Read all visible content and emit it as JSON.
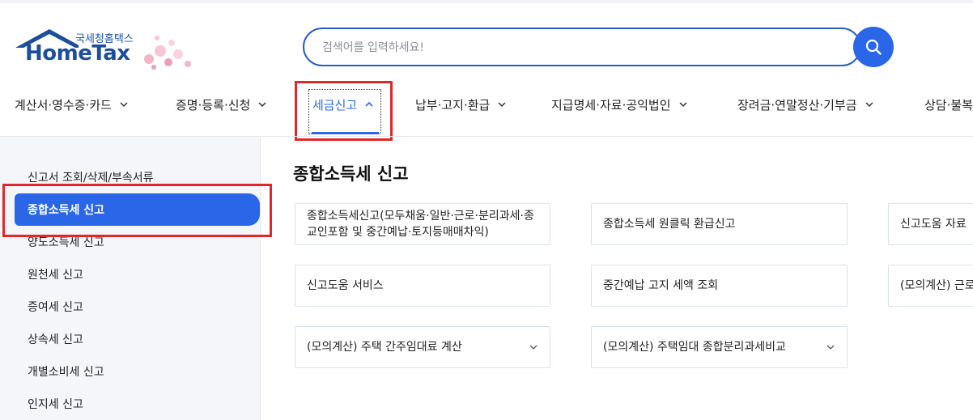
{
  "header": {
    "brand_ko": "국세청홈택스",
    "brand_en": "HomeTax",
    "search_placeholder": "검색어를 입력하세요!"
  },
  "gnb": [
    {
      "label": "계산서·영수증·카드",
      "state": "collapsed"
    },
    {
      "label": "증명·등록·신청",
      "state": "collapsed"
    },
    {
      "label": "세금신고",
      "state": "expanded"
    },
    {
      "label": "납부·고지·환급",
      "state": "collapsed"
    },
    {
      "label": "지급명세·자료·공익법인",
      "state": "collapsed"
    },
    {
      "label": "장려금·연말정산·기부금",
      "state": "collapsed"
    },
    {
      "label": "상담·불복"
    }
  ],
  "sidebar": {
    "items": [
      {
        "label": "신고서 조회/삭제/부속서류"
      },
      {
        "label": "종합소득세 신고",
        "active": true
      },
      {
        "label": "양도소득세 신고"
      },
      {
        "label": "원천세 신고"
      },
      {
        "label": "증여세 신고"
      },
      {
        "label": "상속세 신고"
      },
      {
        "label": "개별소비세 신고"
      },
      {
        "label": "인지세 신고"
      }
    ]
  },
  "main": {
    "title": "종합소득세 신고",
    "cards": [
      {
        "label": "종합소득세신고(모두채움·일반·근로·분리과세·종교인포함 및 중간예납·토지등매매차익)"
      },
      {
        "label": "종합소득세 원클릭 환급신고"
      },
      {
        "label": "신고도움 자료"
      },
      {
        "label": "신고도움 서비스"
      },
      {
        "label": "중간예납 고지 세액 조회"
      },
      {
        "label": "(모의계산) 근로"
      },
      {
        "label": "(모의계산) 주택 간주임대료 계산",
        "dropdown": true
      },
      {
        "label": "(모의계산) 주택임대 종합분리과세비교",
        "dropdown": true
      }
    ]
  },
  "colors": {
    "accent": "#2a67e8",
    "highlight": "#e3262a",
    "sidebar_bg": "#f4f6f9"
  }
}
